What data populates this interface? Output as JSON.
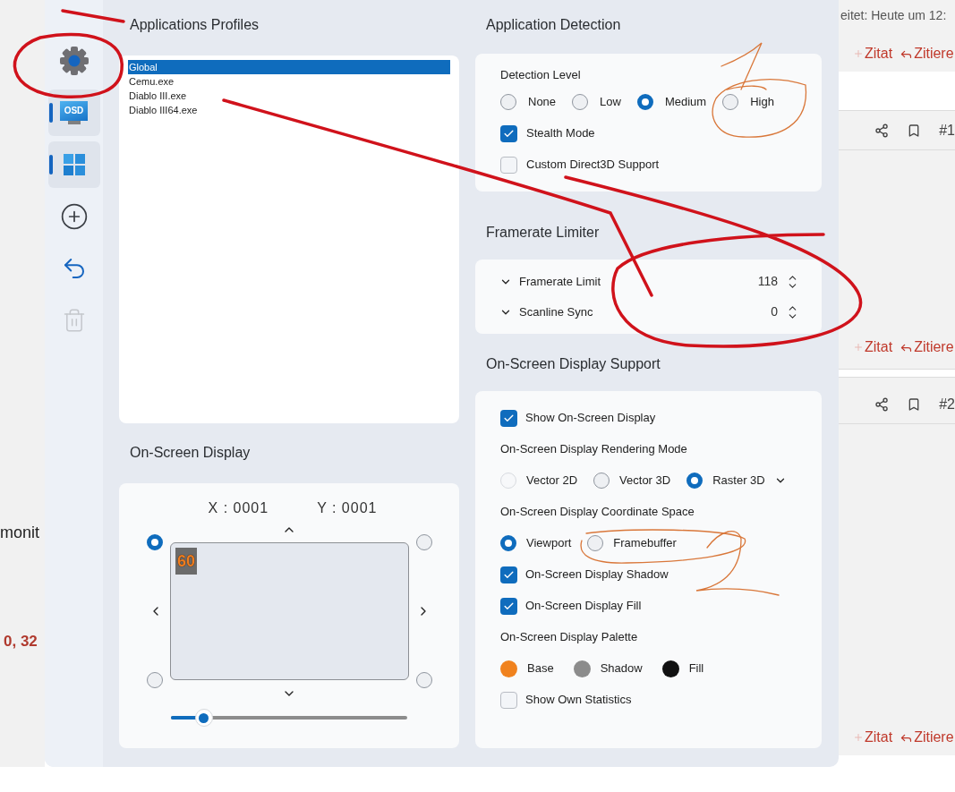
{
  "forum_left": {
    "fragment_1": "monit",
    "fragment_2": "0, 32"
  },
  "forum_right": {
    "edited": "eitet: Heute um 12:",
    "top_actions": {
      "quote": "Zitat",
      "reply": "Zitiere"
    },
    "posts": [
      {
        "number": "#1",
        "quote": "Zitat",
        "reply": "Zitiere"
      },
      {
        "number": "#2",
        "quote": "Zitat",
        "reply": "Zitiere"
      }
    ]
  },
  "sidebar": [
    {
      "kind": "gear",
      "selected": false,
      "disabled": false
    },
    {
      "kind": "osd",
      "label": "OSD",
      "selected": true,
      "disabled": false
    },
    {
      "kind": "windows",
      "selected": true,
      "disabled": false
    },
    {
      "kind": "add",
      "selected": false,
      "disabled": false
    },
    {
      "kind": "undo",
      "selected": false,
      "disabled": false
    },
    {
      "kind": "trash",
      "selected": false,
      "disabled": true
    }
  ],
  "profiles": {
    "title": "Applications Profiles",
    "items": [
      {
        "name": "Global",
        "selected": true
      },
      {
        "name": "Cemu.exe",
        "selected": false
      },
      {
        "name": "Diablo III.exe",
        "selected": false
      },
      {
        "name": "Diablo III64.exe",
        "selected": false
      }
    ]
  },
  "osd": {
    "title": "On-Screen Display",
    "x": "X : 0001",
    "y": "Y : 0001",
    "preview_text": "60",
    "corners": [
      {
        "selected": true
      },
      {
        "selected": false
      },
      {
        "selected": false
      },
      {
        "selected": false
      }
    ],
    "level": 0.14
  },
  "detection": {
    "title": "Application Detection",
    "label": "Detection Level",
    "levels": [
      {
        "label": "None",
        "selected": false
      },
      {
        "label": "Low",
        "selected": false
      },
      {
        "label": "Medium",
        "selected": true
      },
      {
        "label": "High",
        "selected": false
      }
    ],
    "options": [
      {
        "label": "Stealth Mode",
        "checked": true
      },
      {
        "label": "Custom Direct3D Support",
        "checked": false
      }
    ]
  },
  "limiter": {
    "title": "Framerate Limiter",
    "rows": [
      {
        "label": "Framerate Limit",
        "value": "118"
      },
      {
        "label": "Scanline Sync",
        "value": "0"
      }
    ]
  },
  "osd_support": {
    "title": "On-Screen Display Support",
    "items": [
      {
        "kind": "check",
        "label": "Show On-Screen Display",
        "checked": true
      },
      {
        "kind": "heading",
        "label": "On-Screen Display Rendering Mode"
      },
      {
        "kind": "radios",
        "dropdown": true,
        "options": [
          {
            "label": "Vector 2D",
            "selected": false,
            "disabled": true
          },
          {
            "label": "Vector 3D",
            "selected": false,
            "disabled": false
          },
          {
            "label": "Raster 3D",
            "selected": true,
            "disabled": false
          }
        ]
      },
      {
        "kind": "heading",
        "label": "On-Screen Display Coordinate Space"
      },
      {
        "kind": "radios",
        "dropdown": false,
        "options": [
          {
            "label": "Viewport",
            "selected": true,
            "disabled": false
          },
          {
            "label": "Framebuffer",
            "selected": false,
            "disabled": false
          }
        ]
      },
      {
        "kind": "check",
        "label": "On-Screen Display Shadow",
        "checked": true
      },
      {
        "kind": "check",
        "label": "On-Screen Display Fill",
        "checked": true
      },
      {
        "kind": "heading",
        "label": "On-Screen Display Palette"
      },
      {
        "kind": "palette",
        "colors": [
          {
            "label": "Base",
            "color": "#f0821e"
          },
          {
            "label": "Shadow",
            "color": "#8c8c8c"
          },
          {
            "label": "Fill",
            "color": "#111111"
          }
        ]
      },
      {
        "kind": "check",
        "label": "Show Own Statistics",
        "checked": false
      }
    ]
  }
}
